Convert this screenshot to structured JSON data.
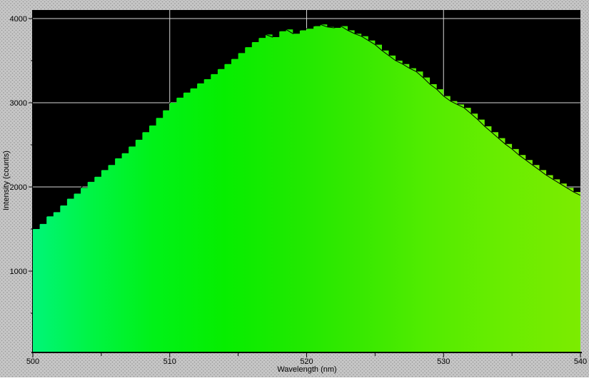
{
  "window": {
    "bg_color": "#c7c7c7",
    "plot_bg_color": "#000000",
    "grid_color": "#d6d6d6",
    "axis_color": "#000000",
    "outline_color": "#000000"
  },
  "chart_data": {
    "type": "area",
    "title": "",
    "xlabel": "Wavelength (nm)",
    "ylabel": "Intensity (counts)",
    "xlim": [
      500,
      540
    ],
    "ylim": [
      0,
      4096
    ],
    "grid": "on",
    "legend": "none",
    "xticks": {
      "major": [
        500,
        510,
        520,
        530,
        540
      ],
      "minor": [
        505,
        515,
        525,
        535
      ]
    },
    "yticks": {
      "major": [
        1000,
        2000,
        3000,
        4000
      ],
      "minor": [
        500,
        1500,
        2500,
        3500
      ]
    },
    "gridlines": {
      "horizontal": [
        1000,
        2000,
        3000,
        4000
      ],
      "vertical": [
        510,
        520,
        530
      ]
    },
    "fill_gradient": [
      [
        0.0,
        "#00F578"
      ],
      [
        0.1,
        "#00F447"
      ],
      [
        0.22,
        "#00F218"
      ],
      [
        0.35,
        "#06EE00"
      ],
      [
        0.48,
        "#1FE900"
      ],
      [
        0.6,
        "#38E900"
      ],
      [
        0.72,
        "#52EC00"
      ],
      [
        0.85,
        "#68ED00"
      ],
      [
        1.0,
        "#7CEC00"
      ]
    ],
    "points": [
      [
        500.0,
        1500
      ],
      [
        500.5,
        1560
      ],
      [
        501.0,
        1650
      ],
      [
        501.5,
        1700
      ],
      [
        502.0,
        1780
      ],
      [
        502.5,
        1860
      ],
      [
        503.0,
        1920
      ],
      [
        503.5,
        1990
      ],
      [
        504.0,
        2060
      ],
      [
        504.5,
        2120
      ],
      [
        505.0,
        2200
      ],
      [
        505.5,
        2260
      ],
      [
        506.0,
        2340
      ],
      [
        506.5,
        2400
      ],
      [
        507.0,
        2480
      ],
      [
        507.5,
        2560
      ],
      [
        508.0,
        2650
      ],
      [
        508.5,
        2730
      ],
      [
        509.0,
        2820
      ],
      [
        509.5,
        2910
      ],
      [
        510.0,
        3000
      ],
      [
        510.5,
        3060
      ],
      [
        511.0,
        3120
      ],
      [
        511.5,
        3170
      ],
      [
        512.0,
        3230
      ],
      [
        512.5,
        3280
      ],
      [
        513.0,
        3340
      ],
      [
        513.5,
        3400
      ],
      [
        514.0,
        3460
      ],
      [
        514.5,
        3520
      ],
      [
        515.0,
        3590
      ],
      [
        515.5,
        3660
      ],
      [
        516.0,
        3720
      ],
      [
        516.5,
        3770
      ],
      [
        517.0,
        3810
      ],
      [
        517.5,
        3780
      ],
      [
        518.0,
        3850
      ],
      [
        518.5,
        3870
      ],
      [
        519.0,
        3820
      ],
      [
        519.5,
        3860
      ],
      [
        520.0,
        3880
      ],
      [
        520.5,
        3910
      ],
      [
        521.0,
        3930
      ],
      [
        521.5,
        3900
      ],
      [
        522.0,
        3890
      ],
      [
        522.5,
        3910
      ],
      [
        523.0,
        3860
      ],
      [
        523.5,
        3820
      ],
      [
        524.0,
        3790
      ],
      [
        524.5,
        3740
      ],
      [
        525.0,
        3690
      ],
      [
        525.5,
        3620
      ],
      [
        526.0,
        3560
      ],
      [
        526.5,
        3500
      ],
      [
        527.0,
        3460
      ],
      [
        527.5,
        3410
      ],
      [
        528.0,
        3370
      ],
      [
        528.5,
        3300
      ],
      [
        529.0,
        3220
      ],
      [
        529.5,
        3160
      ],
      [
        530.0,
        3080
      ],
      [
        530.5,
        3020
      ],
      [
        531.0,
        2980
      ],
      [
        531.5,
        2940
      ],
      [
        532.0,
        2870
      ],
      [
        532.5,
        2800
      ],
      [
        533.0,
        2720
      ],
      [
        533.5,
        2650
      ],
      [
        534.0,
        2580
      ],
      [
        534.5,
        2510
      ],
      [
        535.0,
        2450
      ],
      [
        535.5,
        2380
      ],
      [
        536.0,
        2320
      ],
      [
        536.5,
        2260
      ],
      [
        537.0,
        2200
      ],
      [
        537.5,
        2140
      ],
      [
        538.0,
        2090
      ],
      [
        538.5,
        2040
      ],
      [
        539.0,
        1990
      ],
      [
        539.5,
        1940
      ],
      [
        540.0,
        1900
      ]
    ]
  }
}
